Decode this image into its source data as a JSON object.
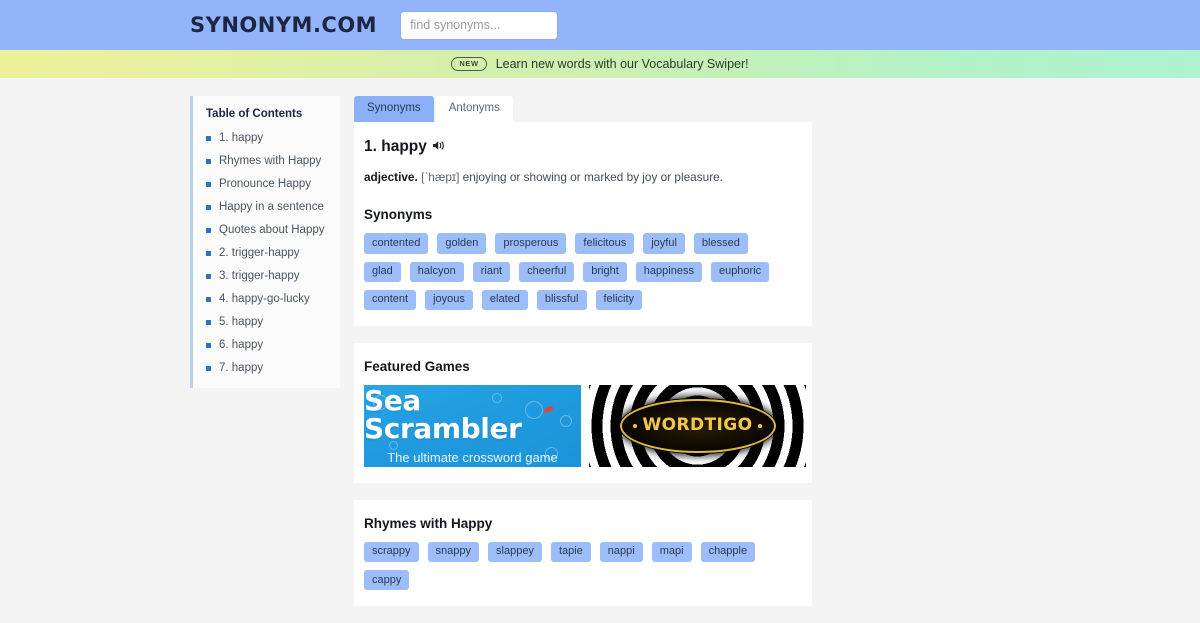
{
  "header": {
    "brand": "SYNONYM.COM",
    "search": {
      "placeholder": "find synonyms...",
      "value": ""
    }
  },
  "promo": {
    "badge": "NEW",
    "text": "Learn new words with our Vocabulary Swiper!"
  },
  "toc": {
    "title": "Table of Contents",
    "items": [
      {
        "label": "1. happy"
      },
      {
        "label": "Rhymes with Happy"
      },
      {
        "label": "Pronounce Happy"
      },
      {
        "label": "Happy in a sentence"
      },
      {
        "label": "Quotes about Happy"
      },
      {
        "label": "2. trigger-happy"
      },
      {
        "label": "3. trigger-happy"
      },
      {
        "label": "4. happy-go-lucky"
      },
      {
        "label": "5. happy"
      },
      {
        "label": "6. happy"
      },
      {
        "label": "7. happy"
      }
    ]
  },
  "tabs": [
    {
      "label": "Synonyms",
      "active": true
    },
    {
      "label": "Antonyms",
      "active": false
    }
  ],
  "entry": {
    "title": "1. happy",
    "speaker_icon": "speaker-icon",
    "pos": "adjective.",
    "ipa": "[ˈhæpɪ]",
    "definition": "enjoying or showing or marked by joy or pleasure."
  },
  "synonyms": {
    "heading": "Synonyms",
    "tags": [
      "contented",
      "golden",
      "prosperous",
      "felicitous",
      "joyful",
      "blessed",
      "glad",
      "halcyon",
      "riant",
      "cheerful",
      "bright",
      "happiness",
      "euphoric",
      "content",
      "joyous",
      "elated",
      "blissful",
      "felicity"
    ]
  },
  "featured_games": {
    "heading": "Featured Games",
    "games": [
      {
        "name": "sea-scrambler",
        "title": "Sea Scrambler",
        "subtitle": "The ultimate crossword game"
      },
      {
        "name": "wordtigo",
        "title": "WORDTIGO"
      }
    ]
  },
  "rhymes": {
    "heading": "Rhymes with Happy",
    "tags": [
      "scrappy",
      "snappy",
      "slappey",
      "tapie",
      "nappi",
      "mapi",
      "chapple",
      "cappy"
    ]
  },
  "colors": {
    "header_blue": "#93b4fb",
    "tag_blue": "#9dbdf8",
    "tab_active": "#8cb0f7",
    "toc_bullet": "#2f6fc4",
    "page_bg": "#f4f4f5",
    "sea_blue": "#1f9ade",
    "wordtigo_gold": "#f2c94c"
  }
}
